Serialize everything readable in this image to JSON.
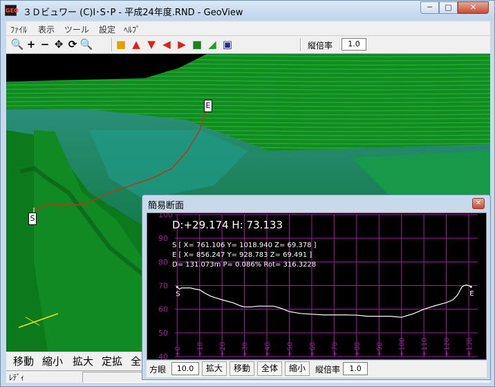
{
  "window": {
    "title": "３Ｄビュワー (C)I･S･P - 平成24年度.RND - GeoView",
    "app_icon_text": "GEO",
    "min_glyph": "─",
    "max_glyph": "□",
    "close_glyph": "✕"
  },
  "menu": [
    "ﾌｧｲﾙ",
    "表示",
    "ツール",
    "設定",
    "ﾍﾙﾌﾟ"
  ],
  "toolbar": {
    "tools": [
      {
        "icon": "zoom-search-icon",
        "glyph": "🔍",
        "color": "#c02020"
      },
      {
        "icon": "plus-icon",
        "glyph": "+",
        "color": "#000000"
      },
      {
        "icon": "minus-icon",
        "glyph": "−",
        "color": "#000000"
      },
      {
        "icon": "move-icon",
        "glyph": "✥",
        "color": "#000000"
      },
      {
        "icon": "rotate-icon",
        "glyph": "⟳",
        "color": "#000000"
      },
      {
        "icon": "zoom-extent-icon",
        "glyph": "🔍",
        "color": "#2030b0"
      },
      {
        "icon": "cube-icon",
        "glyph": "■",
        "color": "#e0a000"
      },
      {
        "icon": "arrow-up-icon",
        "glyph": "▲",
        "color": "#e02010"
      },
      {
        "icon": "arrow-down-icon",
        "glyph": "▼",
        "color": "#e02010"
      },
      {
        "icon": "arrow-left-icon",
        "glyph": "◀",
        "color": "#e02010"
      },
      {
        "icon": "arrow-right-icon",
        "glyph": "▶",
        "color": "#e02010"
      },
      {
        "icon": "terrain-box-icon",
        "glyph": "■",
        "color": "#208020"
      },
      {
        "icon": "axes-icon",
        "glyph": "◢",
        "color": "#20a020"
      },
      {
        "icon": "window-icon",
        "glyph": "▣",
        "color": "#203080"
      }
    ],
    "vertical_scale_label": "縦倍率",
    "vertical_scale_value": "1.0"
  },
  "view3d": {
    "start_marker": "S",
    "end_marker": "E",
    "colors": {
      "terrain_dark": "#0a6b18",
      "terrain_light": "#1aa02a",
      "water": "#1a8a6a",
      "route": "#b83818"
    }
  },
  "commands": [
    "移動",
    "縮小",
    "拡大",
    "定拡",
    "全"
  ],
  "status": {
    "text": "ﾚﾃﾞｨ"
  },
  "dialog": {
    "title": "簡易断面",
    "close_glyph": "✕",
    "header": "D:+29.174 H: 73.133",
    "info_s": "S [ X= 761.106 Y= 1018.940 Z= 69.378 ]",
    "info_e": "E [ X= 856.247 Y= 928.783 Z= 69.491 ]",
    "info_d": "D= 131.073m P= 0.086% Rot= 316.3228",
    "bottom": {
      "grid_label": "方眼",
      "grid_value": "10.0",
      "zoom_in": "拡大",
      "move": "移動",
      "all": "全体",
      "zoom_out": "縮小",
      "scale_label": "縦倍率",
      "scale_value": "1.0"
    }
  },
  "chart_data": {
    "type": "line",
    "title": "",
    "xlabel": "",
    "ylabel": "",
    "xlim": [
      -1,
      134
    ],
    "ylim": [
      40,
      100
    ],
    "x_ticks": [
      "+0",
      "+10",
      "+20",
      "+30",
      "+40",
      "+50",
      "+60",
      "+70",
      "+80",
      "+90",
      "+100",
      "+110",
      "+120",
      "+130"
    ],
    "x_tick_values": [
      0,
      10,
      20,
      30,
      40,
      50,
      60,
      70,
      80,
      90,
      100,
      110,
      120,
      130
    ],
    "y_ticks": [
      "40",
      "50",
      "60",
      "70",
      "80",
      "90",
      "100"
    ],
    "y_tick_values": [
      40,
      50,
      60,
      70,
      80,
      90,
      100
    ],
    "grid": true,
    "line_color": "#ffffff",
    "grid_color": "#a020a0",
    "point_labels": [
      {
        "text": "S",
        "x": 0,
        "y": 69.4
      },
      {
        "text": "E",
        "x": 131,
        "y": 69.5
      }
    ],
    "series": [
      {
        "x": [
          0,
          1,
          2,
          4,
          6,
          8,
          10,
          12,
          15,
          20,
          25,
          28,
          30,
          33,
          36,
          40,
          43,
          46,
          50,
          55,
          60,
          65,
          70,
          75,
          80,
          85,
          90,
          95,
          100,
          105,
          110,
          115,
          120,
          123,
          125,
          127,
          128,
          129,
          130,
          131
        ],
        "y": [
          69.4,
          68.5,
          69,
          69,
          69,
          68.5,
          68.2,
          67,
          65.5,
          64,
          62.7,
          61.5,
          61,
          61,
          61.3,
          61.3,
          61.3,
          60.5,
          59,
          58.2,
          57.9,
          57.6,
          57.6,
          57.6,
          57.5,
          57,
          57,
          57,
          56.6,
          58,
          60,
          61.5,
          62.8,
          64,
          66,
          69.5,
          70,
          70.2,
          70,
          69.5
        ]
      }
    ]
  }
}
